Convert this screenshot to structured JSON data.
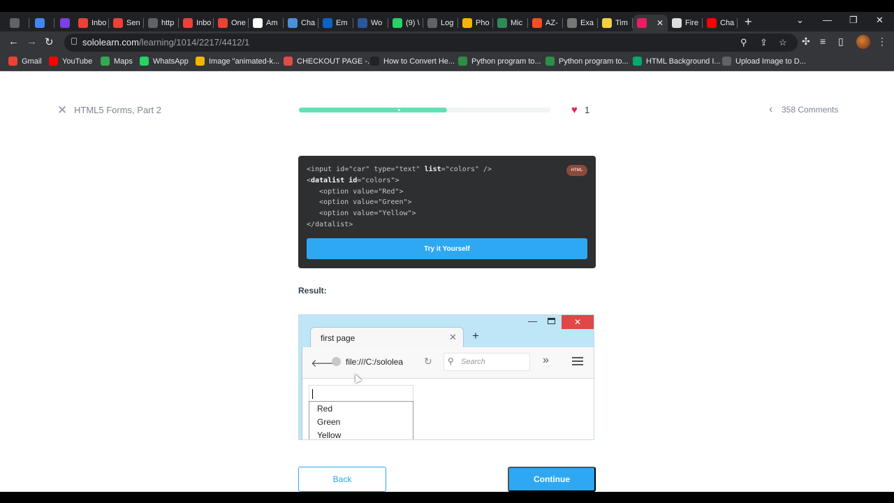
{
  "browser": {
    "tabs": [
      {
        "label": "",
        "icon": "app-icon",
        "color": "#5f6368"
      },
      {
        "label": "",
        "icon": "google-icon",
        "color": "#4285f4"
      },
      {
        "label": "",
        "icon": "shield-icon",
        "color": "#7b3fe4"
      },
      {
        "label": "Inbo",
        "icon": "gmail-icon",
        "color": "#ea4335"
      },
      {
        "label": "Sen",
        "icon": "gmail-icon",
        "color": "#ea4335"
      },
      {
        "label": "http",
        "icon": "globe-icon",
        "color": "#5f6368"
      },
      {
        "label": "Inbo",
        "icon": "gmail-icon",
        "color": "#ea4335"
      },
      {
        "label": "One",
        "icon": "gmail-icon",
        "color": "#ea4335"
      },
      {
        "label": "Am",
        "icon": "amazon-icon",
        "color": "#ffffff"
      },
      {
        "label": "Cha",
        "icon": "chart-icon",
        "color": "#4a90d9"
      },
      {
        "label": "Em",
        "icon": "outlook-icon",
        "color": "#0a64c8"
      },
      {
        "label": "Wo",
        "icon": "word-icon",
        "color": "#2b579a"
      },
      {
        "label": "(9) \\",
        "icon": "whatsapp-icon",
        "color": "#25d366"
      },
      {
        "label": "Log",
        "icon": "globe-icon",
        "color": "#5f6368"
      },
      {
        "label": "Pho",
        "icon": "drive-icon",
        "color": "#f4b400"
      },
      {
        "label": "Mic",
        "icon": "teams-icon",
        "color": "#2e8b57"
      },
      {
        "label": "AZ-",
        "icon": "microsoft-icon",
        "color": "#f25022"
      },
      {
        "label": "Exa",
        "icon": "person-icon",
        "color": "#777777"
      },
      {
        "label": "Tim",
        "icon": "keep-icon",
        "color": "#f4d03f"
      },
      {
        "label": "",
        "icon": "sololearn-icon",
        "color": "#e91e63",
        "active": true
      },
      {
        "label": "Fire",
        "icon": "page-icon",
        "color": "#dddddd"
      },
      {
        "label": "Cha",
        "icon": "youtube-icon",
        "color": "#ff0000"
      }
    ],
    "url_host": "sololearn.com",
    "url_path": "/learning/1014/2217/4412/1",
    "bookmarks": [
      {
        "label": "Gmail",
        "icon": "gmail-icon",
        "color": "#ea4335"
      },
      {
        "label": "YouTube",
        "icon": "youtube-icon",
        "color": "#ff0000"
      },
      {
        "label": "Maps",
        "icon": "maps-icon",
        "color": "#34a853"
      },
      {
        "label": "WhatsApp",
        "icon": "whatsapp-icon",
        "color": "#25d366"
      },
      {
        "label": "Image \"animated-k...",
        "icon": "star-icon",
        "color": "#f4b400"
      },
      {
        "label": "CHECKOUT PAGE -...",
        "icon": "lips-icon",
        "color": "#e04c4c"
      },
      {
        "label": "How to Convert He...",
        "icon": "alpha-icon",
        "color": "#222222"
      },
      {
        "label": "Python program to...",
        "icon": "gfg-icon",
        "color": "#2f8d46"
      },
      {
        "label": "Python program to...",
        "icon": "gfg-icon",
        "color": "#2f8d46"
      },
      {
        "label": "HTML Background I...",
        "icon": "w3-icon",
        "color": "#04aa6d"
      },
      {
        "label": "Upload Image to D...",
        "icon": "globe-icon",
        "color": "#5f6368"
      }
    ]
  },
  "lesson": {
    "title": "HTML5 Forms, Part 2",
    "progress": 0.59,
    "hearts": "1",
    "comments": "358 Comments"
  },
  "code_card": {
    "lang": "HTML",
    "try_label": "Try it Yourself"
  },
  "result": {
    "label": "Result:",
    "tab_title": "first page",
    "url": "file:///C:/sololea",
    "search_placeholder": "Search",
    "options": [
      "Red",
      "Green",
      "Yellow"
    ]
  },
  "footer": {
    "back_label": "Back",
    "continue_label": "Continue"
  }
}
